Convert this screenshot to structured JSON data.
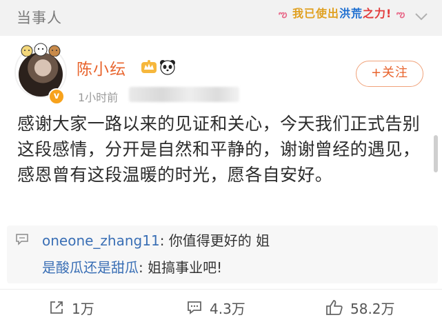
{
  "header": {
    "title": "当事人",
    "badge_part1": "我已使出",
    "badge_part2": "洪荒",
    "badge_part3": "之力!",
    "badge_deco_left": "ఌ",
    "badge_deco_right": "ఌ"
  },
  "post": {
    "username": "陈小纭",
    "time": "1小时前",
    "follow_label": "+关注",
    "verified_mark": "v",
    "body": "感谢大家一路以来的见证和关心，今天我们正式告别这段感情，分开是自然和平静的，谢谢曾经的遇见，感恩曾有这段温暖的时光，愿各自安好。"
  },
  "comments": [
    {
      "user": "oneone_zhang11",
      "separator": ": ",
      "text": "你值得更好的 姐"
    },
    {
      "user": "是酸瓜还是甜瓜",
      "separator": ": ",
      "text": "姐搞事业吧!"
    }
  ],
  "actions": {
    "share_count": "1万",
    "comment_count": "4.3万",
    "like_count": "58.2万"
  },
  "colors": {
    "username": "#e8632c",
    "comment_user": "#3a6fb5",
    "background": "#f2f2f2"
  }
}
